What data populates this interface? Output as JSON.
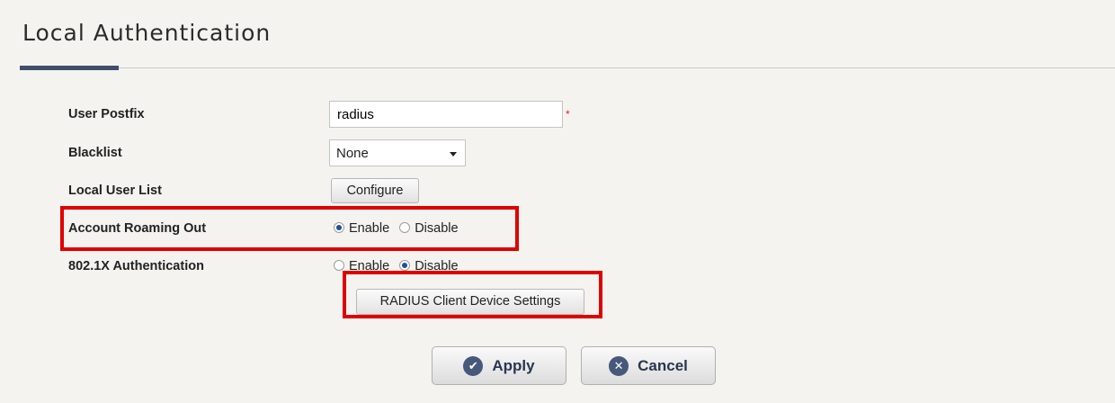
{
  "page": {
    "title": "Local Authentication"
  },
  "form": {
    "user_postfix": {
      "label": "User Postfix",
      "value": "radius",
      "required_mark": "*"
    },
    "blacklist": {
      "label": "Blacklist",
      "selected": "None"
    },
    "local_user_list": {
      "label": "Local User List",
      "button": "Configure"
    },
    "account_roaming_out": {
      "label": "Account Roaming Out",
      "options": [
        {
          "label": "Enable",
          "checked": true
        },
        {
          "label": "Disable",
          "checked": false
        }
      ]
    },
    "dot1x_authentication": {
      "label": "802.1X Authentication",
      "options": [
        {
          "label": "Enable",
          "checked": false
        },
        {
          "label": "Disable",
          "checked": true
        }
      ],
      "button": "RADIUS Client Device Settings"
    }
  },
  "actions": {
    "apply": "Apply",
    "cancel": "Cancel"
  },
  "icons": {
    "apply": "check-circle-icon",
    "cancel": "x-circle-icon"
  },
  "colors": {
    "highlight": "#e00000",
    "accent": "#3f4f6b",
    "button_text": "#2a3550"
  }
}
